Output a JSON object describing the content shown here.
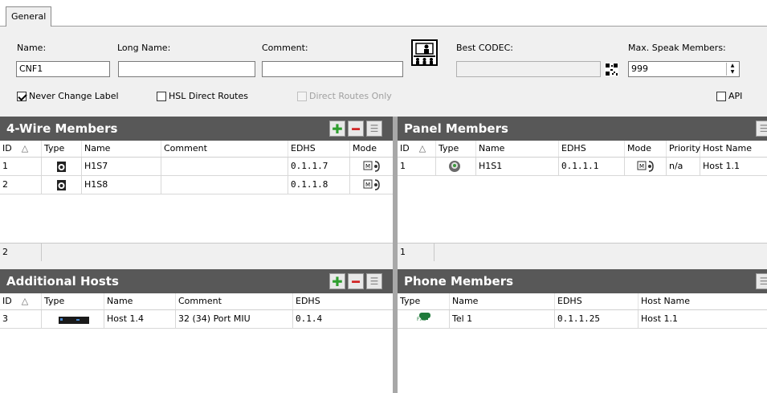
{
  "tab": {
    "label": "General"
  },
  "form": {
    "name_label": "Name:",
    "name_value": "CNF1",
    "long_name_label": "Long Name:",
    "long_name_value": "",
    "comment_label": "Comment:",
    "comment_value": "",
    "best_codec_label": "Best CODEC:",
    "best_codec_value": "",
    "max_speak_label": "Max. Speak Members:",
    "max_speak_value": "999",
    "never_change_label": "Never Change Label",
    "hsl_direct_routes": "HSL Direct Routes",
    "direct_routes_only": "Direct Routes Only",
    "api": "API"
  },
  "fourwire": {
    "title": "4-Wire Members",
    "cols": {
      "id": "ID",
      "sort": "△",
      "type": "Type",
      "name": "Name",
      "comment": "Comment",
      "edhs": "EDHS",
      "mode": "Mode"
    },
    "rows": [
      {
        "id": "1",
        "name": "H1S7",
        "comment": "",
        "edhs": "0.1.1.7"
      },
      {
        "id": "2",
        "name": "H1S8",
        "comment": "",
        "edhs": "0.1.1.8"
      }
    ],
    "count": "2"
  },
  "panel": {
    "title": "Panel Members",
    "cols": {
      "id": "ID",
      "sort": "△",
      "type": "Type",
      "name": "Name",
      "edhs": "EDHS",
      "mode": "Mode",
      "priority": "Priority",
      "host": "Host Name"
    },
    "rows": [
      {
        "id": "1",
        "name": "H1S1",
        "edhs": "0.1.1.1",
        "priority": "n/a",
        "host": "Host 1.1"
      }
    ],
    "count": "1"
  },
  "hosts": {
    "title": "Additional Hosts",
    "cols": {
      "id": "ID",
      "sort": "△",
      "type": "Type",
      "name": "Name",
      "comment": "Comment",
      "edhs": "EDHS"
    },
    "rows": [
      {
        "id": "3",
        "name": "Host 1.4",
        "comment": "32 (34) Port MIU",
        "edhs": "0.1.4"
      }
    ]
  },
  "phone": {
    "title": "Phone Members",
    "cols": {
      "type": "Type",
      "name": "Name",
      "edhs": "EDHS",
      "host": "Host Name"
    },
    "rows": [
      {
        "name": "Tel 1",
        "edhs": "0.1.1.25",
        "host": "Host 1.1",
        "icon_text": "FXO"
      }
    ]
  },
  "colors": {
    "header_bg": "#585858",
    "add_green": "#2e9e2e",
    "remove_red": "#d02020"
  }
}
